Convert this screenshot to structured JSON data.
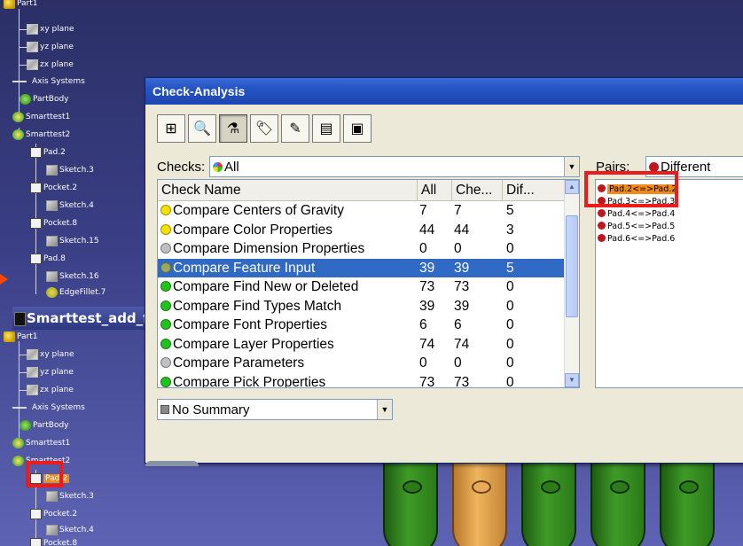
{
  "tree_top": {
    "root": "Part1",
    "planes": [
      "xy plane",
      "yz plane",
      "zx plane"
    ],
    "axis": "Axis Systems",
    "body": "PartBody",
    "set1": "Smarttest1",
    "set2": "Smarttest2",
    "features": [
      {
        "label": "Pad.2",
        "kind": "pad"
      },
      {
        "label": "Sketch.3",
        "kind": "sketch"
      },
      {
        "label": "Pocket.2",
        "kind": "pad"
      },
      {
        "label": "Sketch.4",
        "kind": "sketch"
      },
      {
        "label": "Pocket.8",
        "kind": "pad"
      },
      {
        "label": "Sketch.15",
        "kind": "sketch"
      },
      {
        "label": "Pad.8",
        "kind": "pad"
      },
      {
        "label": "Sketch.16",
        "kind": "sketch"
      },
      {
        "label": "EdgeFillet.7",
        "kind": "fillet"
      }
    ]
  },
  "tree_bottom": {
    "window_title": "Smarttest_add_f",
    "root": "Part1",
    "planes": [
      "xy plane",
      "yz plane",
      "zx plane"
    ],
    "axis": "Axis Systems",
    "body": "PartBody",
    "set1": "Smarttest1",
    "set2": "Smarttest2",
    "features": [
      "Pad.2",
      "Sketch.3",
      "Pocket.2",
      "Sketch.4",
      "Pocket.8"
    ]
  },
  "dialog": {
    "title": "Check-Analysis",
    "toolbar_icons": [
      "tree-icon",
      "zoom-icon",
      "microscope-icon",
      "tag-icon",
      "pencil-icon",
      "report-icon",
      "monitor-icon"
    ],
    "checks_label": "Checks:",
    "checks_value": "All",
    "pairs_label": "Pairs:",
    "pairs_value": "Different",
    "summary_value": "No Summary",
    "columns": [
      "Check Name",
      "All",
      "Che...",
      "Dif..."
    ],
    "rows": [
      {
        "name": "Compare Centers of Gravity",
        "all": "7",
        "checked": "7",
        "diff": "5",
        "status": "#f5e100"
      },
      {
        "name": "Compare Color Properties",
        "all": "44",
        "checked": "44",
        "diff": "3",
        "status": "#f5e100"
      },
      {
        "name": "Compare Dimension Properties",
        "all": "0",
        "checked": "0",
        "diff": "0",
        "status": "#c0c0c0"
      },
      {
        "name": "Compare Feature Input",
        "all": "39",
        "checked": "39",
        "diff": "5",
        "status": "#9aa95a"
      },
      {
        "name": "Compare Find New or Deleted",
        "all": "73",
        "checked": "73",
        "diff": "0",
        "status": "#22c21c"
      },
      {
        "name": "Compare Find Types Match",
        "all": "39",
        "checked": "39",
        "diff": "0",
        "status": "#22c21c"
      },
      {
        "name": "Compare Font Properties",
        "all": "6",
        "checked": "6",
        "diff": "0",
        "status": "#22c21c"
      },
      {
        "name": "Compare Layer Properties",
        "all": "74",
        "checked": "74",
        "diff": "0",
        "status": "#22c21c"
      },
      {
        "name": "Compare Parameters",
        "all": "0",
        "checked": "0",
        "diff": "0",
        "status": "#c0c0c0"
      },
      {
        "name": "Compare Pick Properties",
        "all": "73",
        "checked": "73",
        "diff": "0",
        "status": "#22c21c"
      }
    ],
    "pairs": [
      "Pad.2<=>Pad.2",
      "Pad.3<=>Pad.3",
      "Pad.4<=>Pad.4",
      "Pad.5<=>Pad.5",
      "Pad.6<=>Pad.6"
    ]
  },
  "colors": {
    "selection": "#316ac5",
    "highlight_box": "#ec1c1c",
    "pair_dot": "#c0161c",
    "pair_selected": "#f18a1c"
  }
}
